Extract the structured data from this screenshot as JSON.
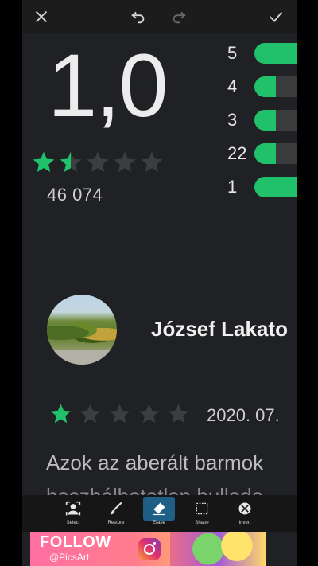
{
  "editor": {
    "close_icon": "close-icon",
    "undo_icon": "undo-icon",
    "redo_icon": "redo-icon",
    "confirm_icon": "check-icon"
  },
  "rating": {
    "score": "1,0",
    "stars_filled": 1.5,
    "stars_total": 5,
    "count": "46 074",
    "accent_color": "#21c16b"
  },
  "distribution": [
    {
      "label": "5",
      "fill": 1.0
    },
    {
      "label": "4",
      "fill": 0.5
    },
    {
      "label": "3",
      "fill": 0.5
    },
    {
      "label": "22",
      "fill": 0.5
    },
    {
      "label": "1",
      "fill": 1.0
    }
  ],
  "review": {
    "author": "József Lakato",
    "stars_filled": 1,
    "stars_total": 5,
    "date": "2020. 07.",
    "text_line1": "Azok az aberált barmok",
    "text_line2": "haszbálhatatlan hullada"
  },
  "tools": [
    {
      "label": "Select",
      "icon": "select-icon",
      "active": false
    },
    {
      "label": "Restore",
      "icon": "brush-icon",
      "active": false
    },
    {
      "label": "Erase",
      "icon": "eraser-icon",
      "active": true
    },
    {
      "label": "Shape",
      "icon": "shape-icon",
      "active": false
    },
    {
      "label": "Invert",
      "icon": "invert-icon",
      "active": false
    }
  ],
  "promo": {
    "follow": "FOLLOW",
    "handle": "@PicsArt",
    "icon": "instagram-icon"
  }
}
